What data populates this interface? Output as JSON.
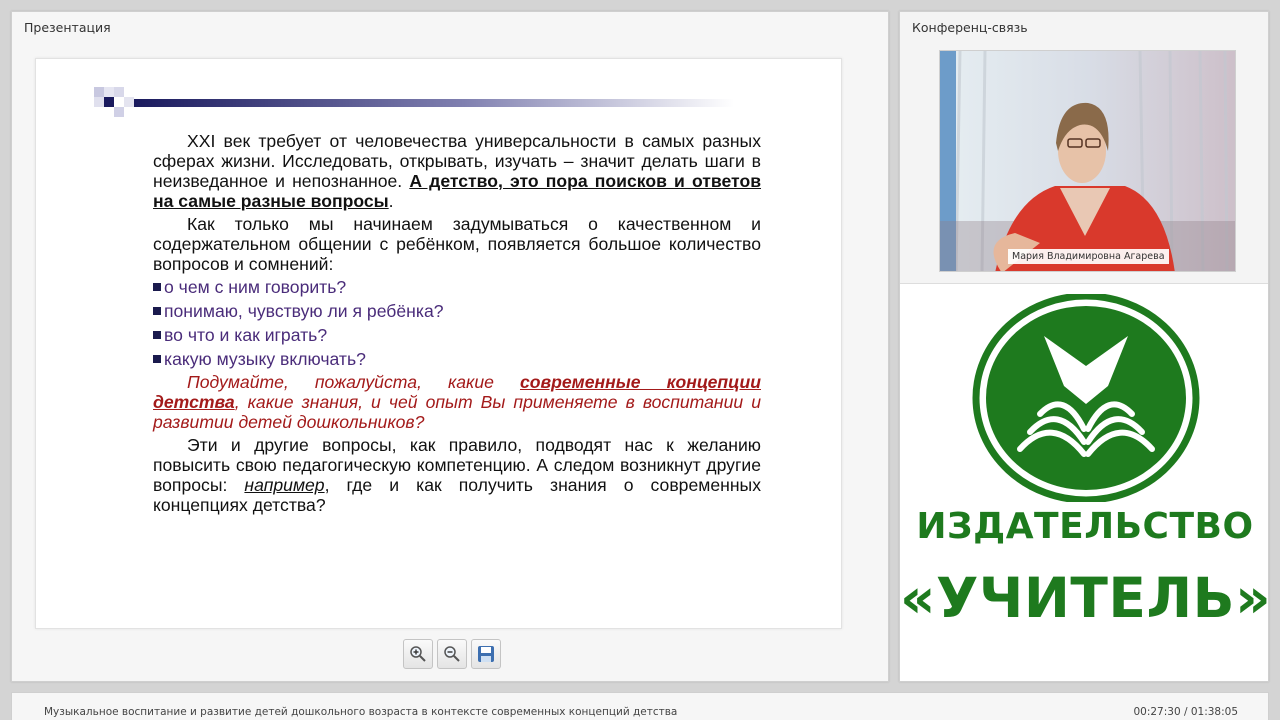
{
  "presentation": {
    "title": "Презентация",
    "slide": {
      "para1_plain": "XXI век требует от человечества универсальности в самых разных сферах жизни.  Исследовать, открывать, изучать – значит делать шаги в неизведанное и непознанное. ",
      "para1_bold": "А детство, это пора поисков и ответов на самые разные вопросы",
      "para1_end": ".",
      "para2": "Как только мы начинаем задумываться о качественном и содержательном общении с ребёнком, появляется большое количество вопросов и сомнений:",
      "bullets": [
        "о чем с ним говорить?",
        "понимаю, чувствую ли я ребёнка?",
        "во что и как играть?",
        "какую музыку включать?"
      ],
      "red_pre": "Подумайте, пожалуйста, какие ",
      "red_strong": "современные концепции детства",
      "red_post": ", какие знания, и чей опыт Вы применяете в воспитании и развитии детей дошкольников?",
      "para4_pre": "Эти и другие вопросы, как правило, подводят нас к желанию повысить свою педагогическую компетенцию. А следом возникнут другие вопросы: ",
      "para4_em": "например",
      "para4_post": ", где и как получить знания о современных концепциях детства?"
    },
    "tools": [
      "zoom-in-icon",
      "zoom-out-icon",
      "save-icon"
    ]
  },
  "conference": {
    "title": "Конференц-связь",
    "speaker_name": "Мария Владимировна Агарева"
  },
  "publisher": {
    "line1": "ИЗДАТЕЛЬСТВО",
    "line2": "«УЧИТЕЛЬ»",
    "color": "#1e7a1e"
  },
  "footer": {
    "webinar_title": "Музыкальное воспитание и развитие детей дошкольного возраста в контексте современных концепций детства",
    "time": "00:27:30 / 01:38:05"
  }
}
